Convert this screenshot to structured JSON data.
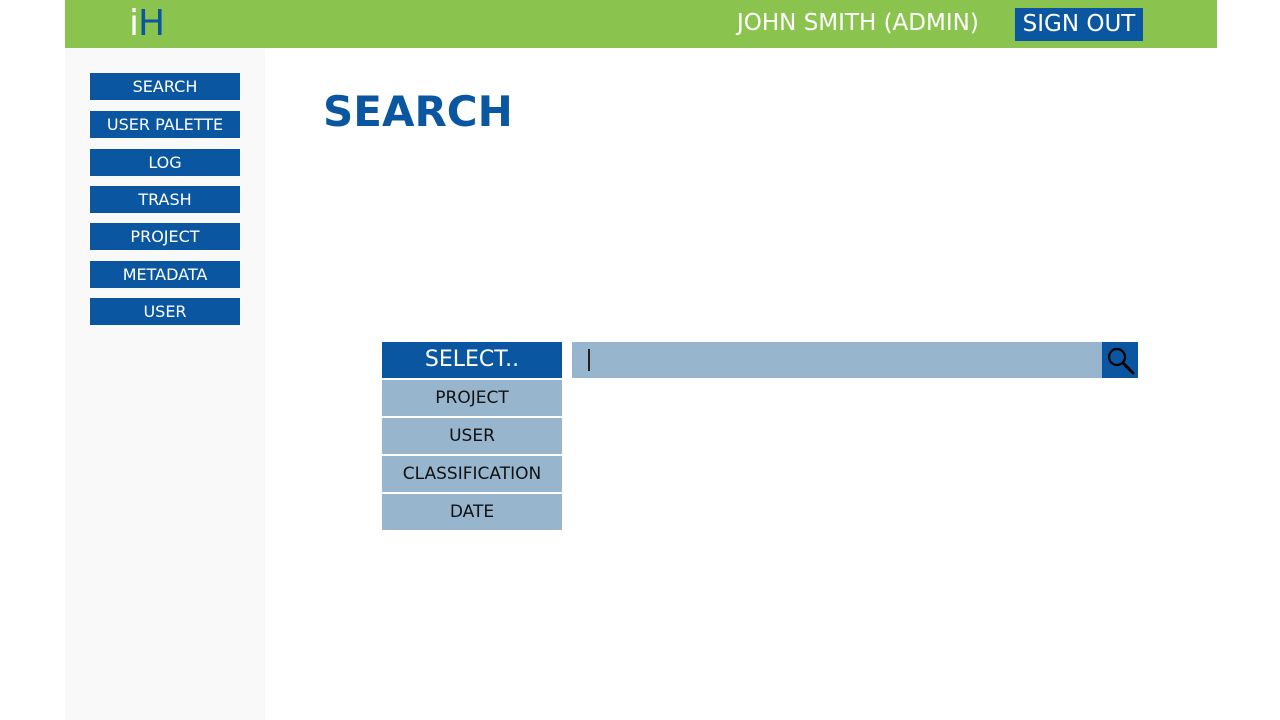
{
  "header": {
    "logo_i": "i",
    "logo_h": "H",
    "user_label": "JOHN SMITH (ADMIN)",
    "sign_out_label": "SIGN OUT"
  },
  "sidebar": {
    "items": [
      {
        "label": "SEARCH"
      },
      {
        "label": "USER PALETTE"
      },
      {
        "label": "LOG"
      },
      {
        "label": "TRASH"
      },
      {
        "label": "PROJECT"
      },
      {
        "label": "METADATA"
      },
      {
        "label": "USER"
      }
    ]
  },
  "main": {
    "title": "SEARCH",
    "select": {
      "label": "SELECT..",
      "options": [
        "PROJECT",
        "USER",
        "CLASSIFICATION",
        "DATE"
      ]
    },
    "search": {
      "value": "",
      "icon": "magnifier-icon"
    }
  },
  "colors": {
    "header_bg": "#8bc34f",
    "primary": "#0a56a0",
    "option_bg": "#97b5cd",
    "sidebar_bg": "#f9f9f9"
  }
}
